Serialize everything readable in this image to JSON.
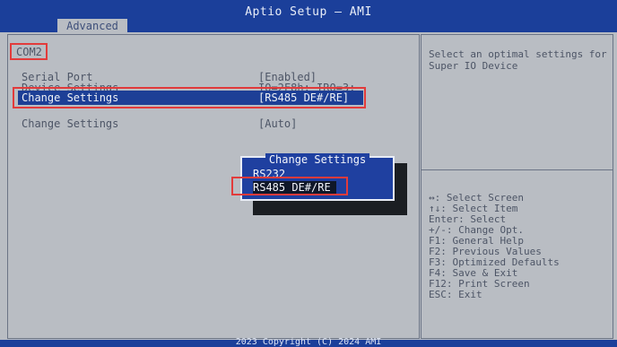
{
  "header": {
    "title": "Aptio Setup – AMI",
    "tab_label": "Advanced"
  },
  "left": {
    "section_title": "COM2",
    "items": [
      {
        "label": "Serial Port",
        "value": "[Enabled]"
      },
      {
        "label": "Device Settings",
        "value": "IO=2F8h; IRQ=3;"
      },
      {
        "label": "Change Settings",
        "value": "[RS485 DE#/RE]",
        "selected": true
      }
    ],
    "extra_item": {
      "label": "Change Settings",
      "value": "[Auto]"
    }
  },
  "popup": {
    "title": "Change Settings",
    "options": [
      "RS232",
      "RS485 DE#/RE"
    ],
    "selected_index": 1
  },
  "help": {
    "description": "Select an optimal settings for\nSuper IO Device",
    "keys": [
      "↔: Select Screen",
      "↑↓: Select Item",
      "Enter: Select",
      "+/-: Change Opt.",
      "F1: General Help",
      "F2: Previous Values",
      "F3: Optimized Defaults",
      "F4: Save & Exit",
      "F12: Print Screen",
      "ESC: Exit"
    ]
  },
  "footer": {
    "text": "2023 Copyright (C) 2024 AMI"
  },
  "colors": {
    "accent_blue": "#1b3f9a",
    "panel_gray": "#b9bdc3",
    "highlight_red": "#e23b3b"
  }
}
